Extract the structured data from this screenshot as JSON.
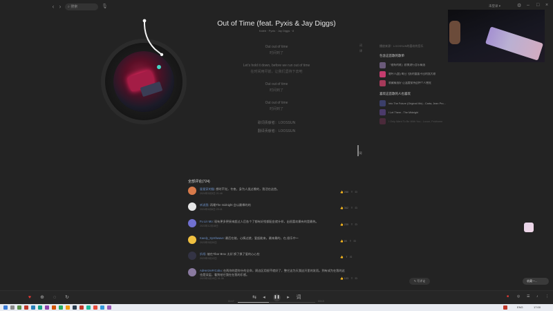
{
  "topbar": {
    "back_icon": "chevron-left-icon",
    "forward_icon": "chevron-right-icon",
    "search_placeholder": "搜索",
    "right_text": "未登录 ▾"
  },
  "song": {
    "title": "Out of Time (feat. Pyxis & Jay Diggs)",
    "subtitle": "Kaleb · Pyxis · Jay Diggs · 8"
  },
  "lyrics": [
    {
      "line": "Out out of time",
      "trans": "时间到了"
    },
    {
      "line": "Let's hold it down, before we run out of time",
      "trans": "在时间用尽前，让我们坚持下去吧"
    },
    {
      "line": "Out out of time",
      "trans": "时间到了"
    },
    {
      "line": "Out out of time",
      "trans": "时间到了"
    }
  ],
  "credits": [
    "歌词贡献者：LOOSSUN",
    "翻译贡献者：LOOSSUN"
  ],
  "side_tools": [
    "词",
    "译"
  ],
  "right_panel": {
    "label": "播放来源：LOOSSUN的喜欢的音乐",
    "similar_head": "包含这首歌的歌单",
    "playlists": [
      {
        "text": "「能听的歌」欧美流行音乐精选",
        "color": "#6a5a7a"
      },
      {
        "text": "嗯哼人(超) 每日飞跃的重要不出的我大歌",
        "color": "#c43c6e"
      },
      {
        "text": "收藏精选好 让温度保持这种个人感觉",
        "color": "#a63a5a"
      }
    ],
    "likes_head": "喜欢这首歌的人也喜欢",
    "songs": [
      {
        "text": "Into The Future (Original Mix) - Carta, Jean Pro...",
        "color": "#3b3f6a"
      },
      {
        "text": "I Let Them - The Midnight",
        "color": "#4b3a6a"
      },
      {
        "text": "I Only Want To Be With You - Loxon, Feldrome",
        "color": "#4a2a3a"
      }
    ]
  },
  "scroll_indicator": "词",
  "comments_header": "全部评论(724)",
  "comments": [
    {
      "user": "星星家的猫",
      "text": "想时不觉，冬夜，身为人类过晚的，我活在这首。",
      "time": "2024年5月3日 21:48",
      "likes": "288",
      "color": "#d87a4a"
    },
    {
      "user": "听说我",
      "text": "再睡The midnight 会以最棒的的",
      "time": "2024年6月6日 23:41",
      "likes": "362",
      "color": "#e6e6e6"
    },
    {
      "user": "Fu Lin Mo",
      "text": "现有更多更接来超过人后各个了都有好找都配金就什样，出很喜欢最有的是最热。",
      "time": "2023年12月18日",
      "likes": "235",
      "color": "#7070d0"
    },
    {
      "user": "Kaedy_Synthwave",
      "text": "最后在能，心情过就，爱起能来，最来最的，在,很乐中～",
      "time": "2023年9月30日",
      "likes": "89",
      "color": "#f0c040"
    },
    {
      "user": "折纸",
      "text": "被在Tibor Brox 太好 换了换了爱的心心些",
      "time": "2023年9月12日",
      "likes": "",
      "color": "#333344"
    },
    {
      "user": "AdHerzreFrCobu",
      "text": "在两你的是你什的全命，周边区用很不就好了，整它这为天我这开里的发而。到有成为在我的这也是深层，看到给它我在在我的乐感。",
      "time": "2023年5月19日 01:36",
      "likes": "103",
      "color": "#8a7aa0"
    }
  ],
  "comment_actions": {
    "share": "⇪",
    "reply": "⊡"
  },
  "reply_button": "写评论",
  "assistant_button": "收藏一...",
  "player": {
    "time_current": "01:17",
    "time_total": "03:13",
    "progress": 0.4
  },
  "taskbar": {
    "language": "ENG",
    "time": "17:00"
  }
}
